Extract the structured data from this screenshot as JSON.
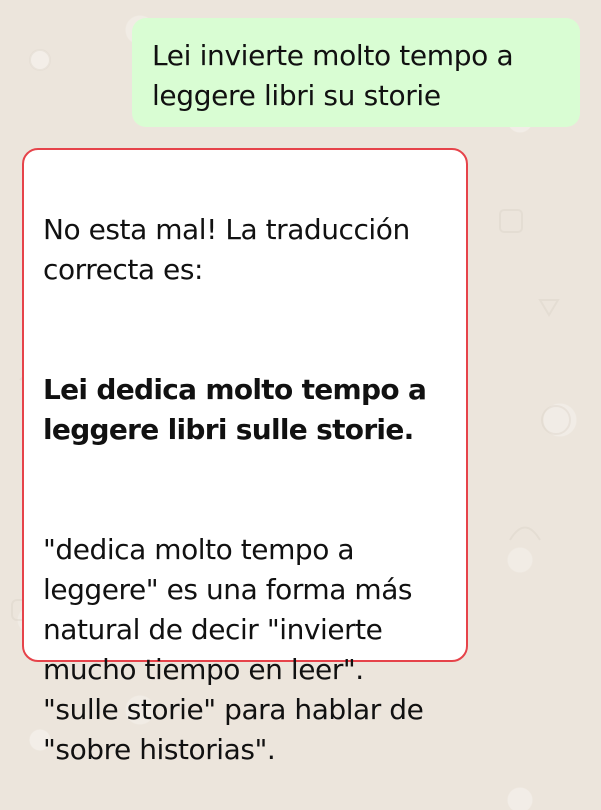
{
  "chat": {
    "messages": [
      {
        "direction": "outgoing",
        "text": "Lei invierte molto tempo a\nleggere libri su storie"
      },
      {
        "direction": "incoming",
        "paragraphs": [
          "No esta mal! La traducción\ncorrecta es:",
          "Lei dedica molto tempo a\nleggere libri sulle storie.",
          "\"dedica molto tempo a\nleggere\" es una forma más\nnatural de decir \"invierte\nmucho tiempo en leer\".\n\"sulle storie\" para hablar de\n\"sobre historias\"."
        ]
      }
    ]
  },
  "colors": {
    "background": "#ece5dc",
    "outgoing_bubble": "#d9fdd3",
    "incoming_bubble": "#ffffff",
    "incoming_border": "#e6434a",
    "text": "#111111"
  }
}
